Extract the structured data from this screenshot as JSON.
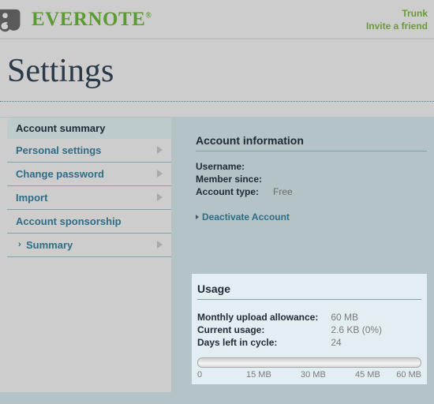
{
  "header": {
    "brand_name": "EVERNOTE",
    "brand_reg": "®",
    "logo_icon": "elephant-logo-icon",
    "links": [
      {
        "label": "Trunk"
      },
      {
        "label": "Invite a friend"
      }
    ]
  },
  "page": {
    "title": "Settings"
  },
  "sidebar": {
    "active": {
      "label": "Account summary"
    },
    "items": [
      {
        "label": "Personal settings",
        "arrow": true,
        "sub": false
      },
      {
        "label": "Change password",
        "arrow": true,
        "sub": false
      },
      {
        "label": "Import",
        "arrow": true,
        "sub": false
      },
      {
        "label": "Account sponsorship",
        "arrow": false,
        "sub": false
      },
      {
        "label": "Summary",
        "arrow": true,
        "sub": true,
        "chevron": "›"
      }
    ]
  },
  "account_information": {
    "heading": "Account information",
    "rows": [
      {
        "label": "Username:",
        "value": ""
      },
      {
        "label": "Member since:",
        "value": ""
      },
      {
        "label": "Account type:",
        "value": "Free"
      }
    ],
    "deactivate_label": "Deactivate Account"
  },
  "usage": {
    "heading": "Usage",
    "rows": [
      {
        "label": "Monthly upload allowance:",
        "value": "60 MB"
      },
      {
        "label": "Current usage:",
        "value": "2.6 KB (0%)"
      },
      {
        "label": "Days left in cycle:",
        "value": "24"
      }
    ],
    "meter_percent": 0,
    "scale": [
      "0",
      "15 MB",
      "30 MB",
      "45 MB",
      "60 MB"
    ]
  },
  "colors": {
    "brand_green": "#5c9a32",
    "link_teal": "#2d6d87",
    "page_bg": "#b4c3c5",
    "panel_gray": "#cdcdcd",
    "usage_panel": "#e3eef3"
  }
}
